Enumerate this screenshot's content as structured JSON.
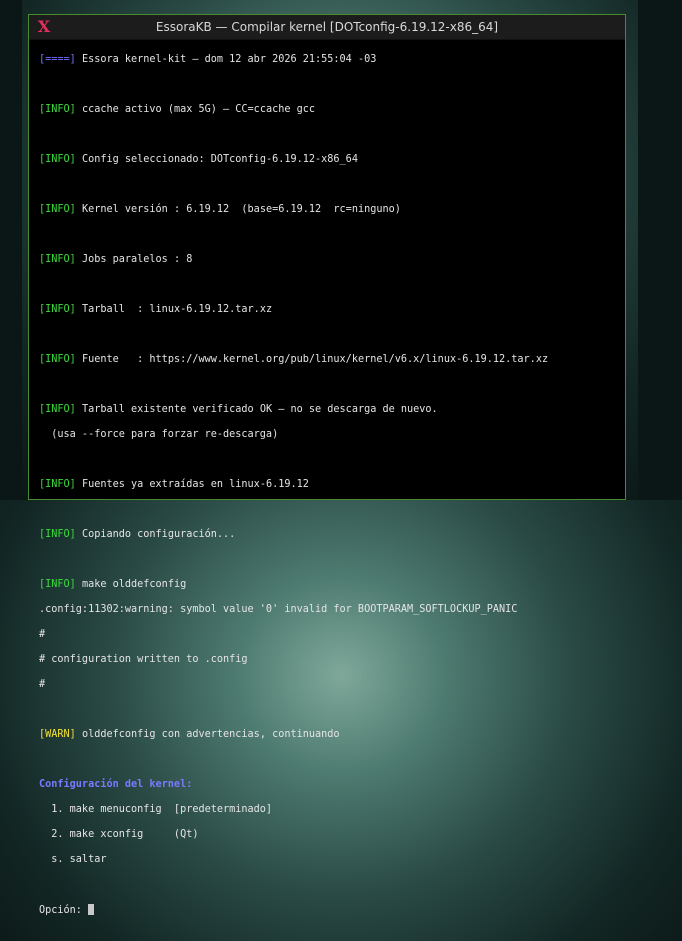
{
  "window": {
    "title": "EssoraKB — Compilar kernel [DOTconfig-6.19.12-x86_64]"
  },
  "terminal": {
    "header_tag": "[====]",
    "header_text": " Essora kernel-kit – dom 12 abr 2026 21:55:04 -03",
    "info_tag": "[INFO]",
    "warn_tag": "[WARN]",
    "l_ccache": " ccache activo (max 5G) — CC=ccache gcc",
    "l_config": " Config seleccionado: DOTconfig-6.19.12-x86_64",
    "l_kernel": " Kernel versión : 6.19.12  (base=6.19.12  rc=ninguno)",
    "l_jobs": " Jobs paralelos : 8",
    "l_tarball": " Tarball  : linux-6.19.12.tar.xz",
    "l_fuente": " Fuente   : https://www.kernel.org/pub/linux/kernel/v6.x/linux-6.19.12.tar.xz",
    "l_verified": " Tarball existente verificado OK — no se descarga de nuevo.",
    "l_force": "  (usa --force para forzar re-descarga)",
    "l_extracted": " Fuentes ya extraídas en linux-6.19.12",
    "l_copying": " Copiando configuración...",
    "l_make": " make olddefconfig",
    "l_warning": ".config:11302:warning: symbol value '0' invalid for BOOTPARAM_SOFTLOCKUP_PANIC",
    "l_hash1": "#",
    "l_written": "# configuration written to .config",
    "l_hash2": "#",
    "l_warn": " olddefconfig con advertencias, continuando",
    "menu_title": "Configuración del kernel:",
    "opt1": "  1. make menuconfig  [predeterminado]",
    "opt2": "  2. make xconfig     (Qt)",
    "opt3": "  s. saltar",
    "prompt": "Opción: "
  },
  "colors": {
    "info": "#3cdc3c",
    "warn": "#f0e030",
    "header": "#6f6fff"
  }
}
